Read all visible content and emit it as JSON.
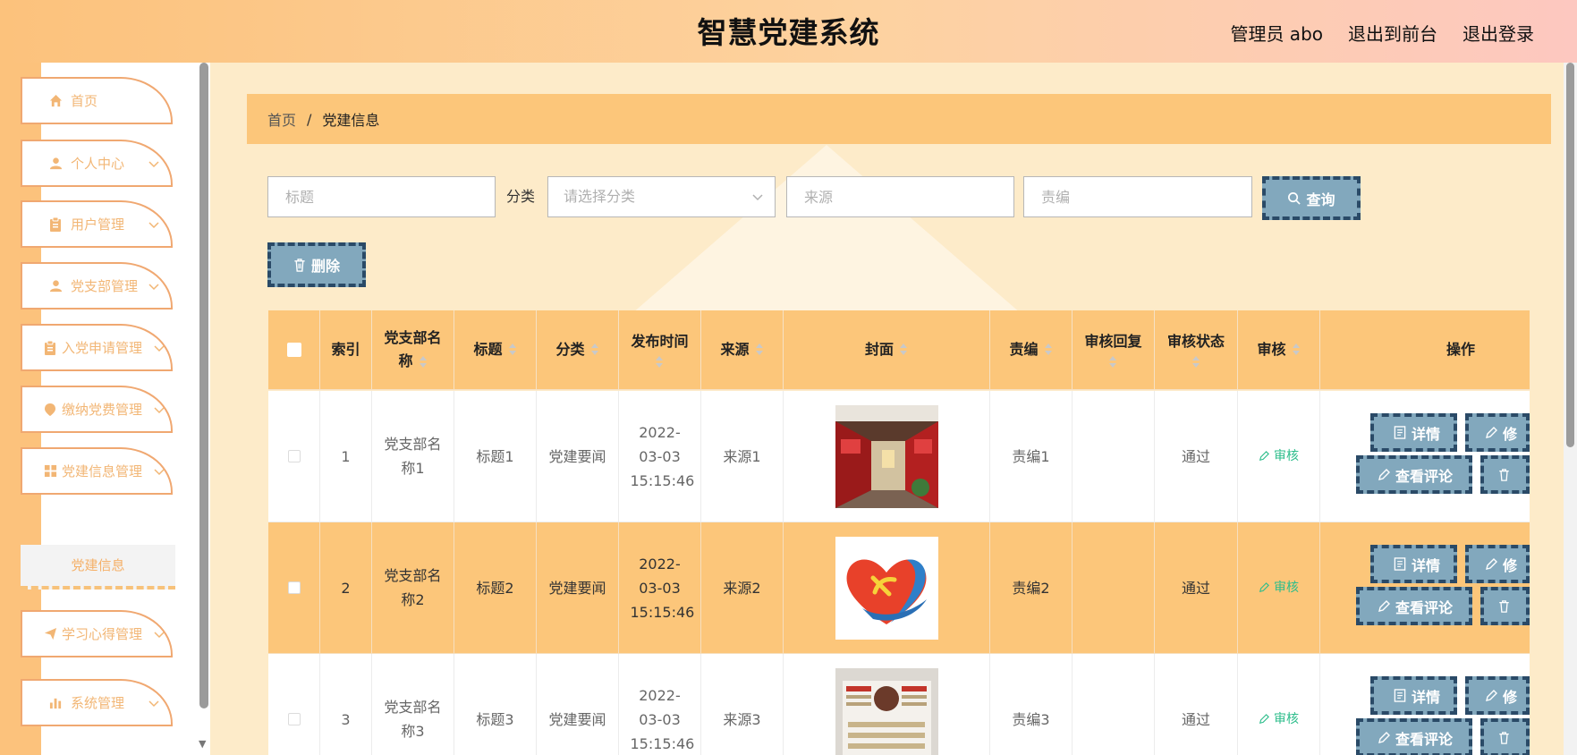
{
  "header": {
    "title": "智慧党建系统",
    "user": "管理员 abo",
    "to_front": "退出到前台",
    "logout": "退出登录"
  },
  "sidebar": {
    "items": [
      {
        "label": "首页",
        "icon": "home-icon"
      },
      {
        "label": "个人中心",
        "icon": "user-icon"
      },
      {
        "label": "用户管理",
        "icon": "clipboard-icon"
      },
      {
        "label": "党支部管理",
        "icon": "user-icon"
      },
      {
        "label": "入党申请管理",
        "icon": "clipboard-icon"
      },
      {
        "label": "缴纳党费管理",
        "icon": "location-pin-icon"
      },
      {
        "label": "党建信息管理",
        "icon": "grid-icon"
      },
      {
        "label": "学习心得管理",
        "icon": "paper-plane-icon"
      },
      {
        "label": "系统管理",
        "icon": "bar-chart-icon"
      }
    ],
    "submenu_active": "党建信息"
  },
  "breadcrumb": {
    "home": "首页",
    "separator": "/",
    "current": "党建信息"
  },
  "search": {
    "title_placeholder": "标题",
    "category_label": "分类",
    "category_placeholder": "请选择分类",
    "source_placeholder": "来源",
    "editor_placeholder": "责编",
    "query_label": "查询",
    "delete_label": "删除"
  },
  "table": {
    "headers": {
      "index": "索引",
      "branch": "党支部名称",
      "title": "标题",
      "category": "分类",
      "publish_time": "发布时间",
      "source": "来源",
      "cover": "封面",
      "editor": "责编",
      "reply": "审核回复",
      "status": "审核状态",
      "audit": "审核",
      "ops": "操作"
    },
    "rows": [
      {
        "index": "1",
        "branch": "党支部名称1",
        "title": "标题1",
        "category": "党建要闻",
        "publish_time": "2022-03-03 15:15:46",
        "source": "来源1",
        "editor": "责编1",
        "reply": "",
        "status": "通过",
        "audit": "审核",
        "cover": "room-photo"
      },
      {
        "index": "2",
        "branch": "党支部名称2",
        "title": "标题2",
        "category": "党建要闻",
        "publish_time": "2022-03-03 15:15:46",
        "source": "来源2",
        "editor": "责编2",
        "reply": "",
        "status": "通过",
        "audit": "审核",
        "cover": "heart-emblem"
      },
      {
        "index": "3",
        "branch": "党支部名称3",
        "title": "标题3",
        "category": "党建要闻",
        "publish_time": "2022-03-03 15:15:46",
        "source": "来源3",
        "editor": "责编3",
        "reply": "",
        "status": "通过",
        "audit": "审核",
        "cover": "wall-poster"
      }
    ],
    "actions": {
      "detail": "详情",
      "edit": "修",
      "comments": "查看评论"
    }
  },
  "colors": {
    "header_gradient_start": "#fcc27c",
    "header_gradient_end": "#fdc8c0",
    "accent": "#fcc67a",
    "button_bg": "#82a8bd",
    "button_border": "#2a4a67",
    "menu_text": "#f2b675",
    "audit_green": "#2dbd8b"
  }
}
